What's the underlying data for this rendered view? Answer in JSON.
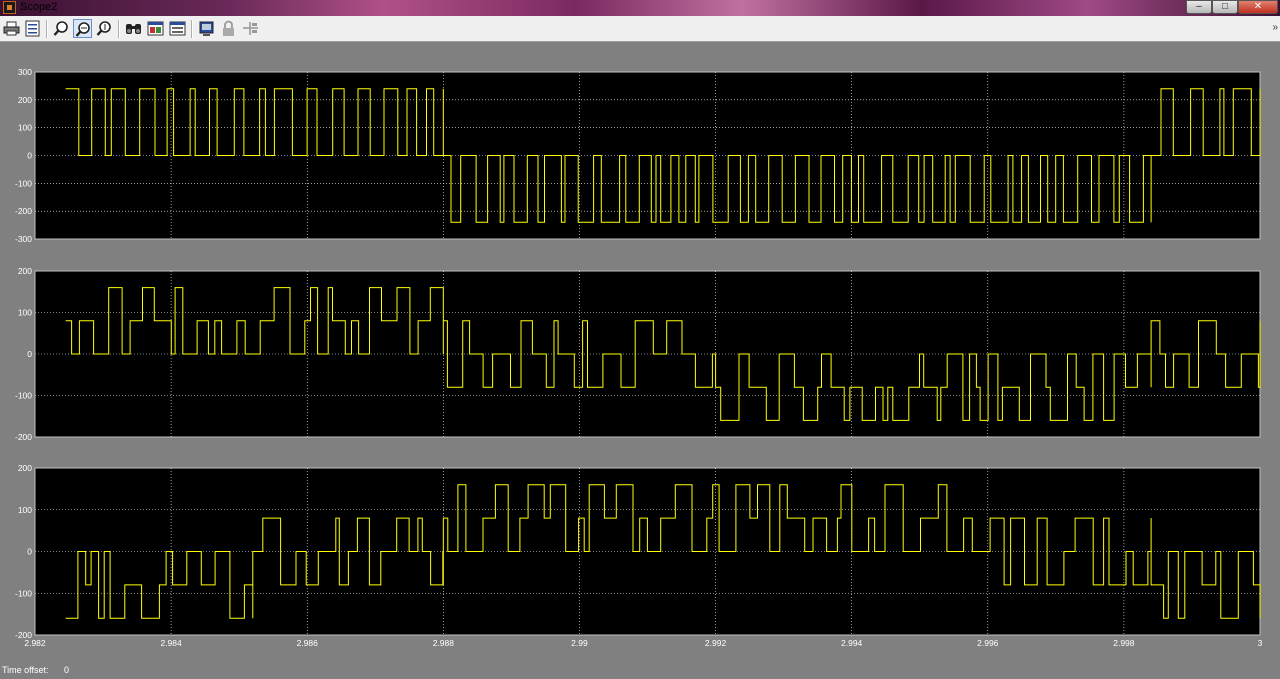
{
  "window": {
    "title": "Scope2",
    "minimize_glyph": "–",
    "maximize_glyph": "□",
    "close_glyph": "✕"
  },
  "toolbar": {
    "buttons": [
      {
        "name": "print-icon",
        "tooltip": ""
      },
      {
        "name": "parameters-icon",
        "tooltip": ""
      },
      {
        "name": "zoom-icon",
        "tooltip": ""
      },
      {
        "name": "zoom-x-icon",
        "tooltip": ""
      },
      {
        "name": "zoom-y-icon",
        "tooltip": ""
      },
      {
        "name": "autoscale-icon",
        "tooltip": ""
      },
      {
        "name": "save-axes-icon",
        "tooltip": ""
      },
      {
        "name": "restore-axes-icon",
        "tooltip": ""
      },
      {
        "name": "floating-scope-icon",
        "tooltip": ""
      },
      {
        "name": "lock-axes-icon",
        "tooltip": ""
      },
      {
        "name": "signal-selector-icon",
        "tooltip": ""
      }
    ],
    "overflow_glyph": "»"
  },
  "status": {
    "time_offset_label": "Time offset:",
    "time_offset_value": "0"
  },
  "colors": {
    "plot_bg": "#000000",
    "frame_bg": "#808080",
    "trace": "#ffff00",
    "grid": "#ffffff",
    "tick_text": "#ffffff"
  },
  "chart_data": [
    {
      "type": "line",
      "title": "",
      "xlabel": "",
      "ylabel": "",
      "xlim": [
        2.982,
        3.0
      ],
      "ylim": [
        -300,
        300
      ],
      "yticks": [
        "300",
        "200",
        "100",
        "0",
        "-100",
        "-200",
        "-300"
      ],
      "grid": true,
      "description_levels": [
        240,
        0,
        -240
      ],
      "series": [
        {
          "pattern": [
            [
              2.98245,
              2.988,
              [
                240,
                0
              ]
            ],
            [
              2.988,
              2.9984,
              [
                0,
                -240
              ]
            ],
            [
              2.9984,
              3.0,
              [
                0,
                240
              ]
            ]
          ]
        }
      ]
    },
    {
      "type": "line",
      "title": "",
      "xlabel": "",
      "ylabel": "",
      "xlim": [
        2.982,
        3.0
      ],
      "ylim": [
        -200,
        200
      ],
      "yticks": [
        "200",
        "100",
        "0",
        "-100",
        "-200"
      ],
      "grid": true,
      "series": [
        {
          "pattern": [
            [
              2.98245,
              2.988,
              [
                80,
                160,
                0
              ]
            ],
            [
              2.988,
              2.992,
              [
                80,
                0,
                -80
              ]
            ],
            [
              2.992,
              2.9984,
              [
                -80,
                -160,
                0
              ]
            ],
            [
              2.9984,
              3.0,
              [
                80,
                0,
                -80
              ]
            ]
          ]
        }
      ]
    },
    {
      "type": "line",
      "title": "",
      "xlabel": "",
      "ylabel": "",
      "xlim": [
        2.982,
        3.0
      ],
      "ylim": [
        -200,
        200
      ],
      "yticks": [
        "200",
        "100",
        "0",
        "-100",
        "-200"
      ],
      "xticks": [
        "2.982",
        "2.984",
        "2.986",
        "2.988",
        "2.99",
        "2.992",
        "2.994",
        "2.996",
        "2.998",
        "3"
      ],
      "grid": true,
      "series": [
        {
          "pattern": [
            [
              2.98245,
              2.9852,
              [
                -160,
                -80,
                0
              ]
            ],
            [
              2.9852,
              2.988,
              [
                0,
                80,
                -80
              ]
            ],
            [
              2.988,
              2.9954,
              [
                80,
                160,
                0
              ]
            ],
            [
              2.9954,
              2.9984,
              [
                0,
                80,
                -80
              ]
            ],
            [
              2.9984,
              3.0,
              [
                -80,
                -160,
                0
              ]
            ]
          ]
        }
      ]
    }
  ]
}
